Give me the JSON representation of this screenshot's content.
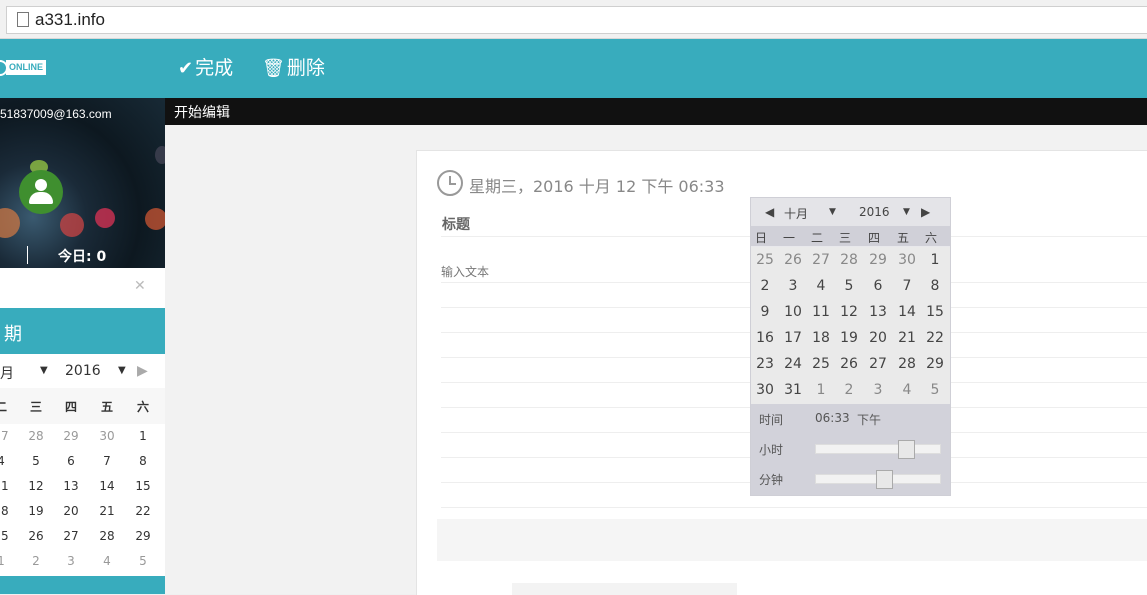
{
  "browser": {
    "url": "a331.info"
  },
  "topnav": {
    "logo_text": "ONLINE",
    "done_label": "完成",
    "delete_label": "删除"
  },
  "sidebar": {
    "email": "51837009@163.com",
    "today_label": "今日: ",
    "today_value": "0",
    "calendar_title": "期",
    "month_label": "月",
    "year_label": "2016",
    "weekdays": [
      "二",
      "三",
      "四",
      "五",
      "六"
    ],
    "weeks": [
      [
        "27",
        "28",
        "29",
        "30",
        "1"
      ],
      [
        "4",
        "5",
        "6",
        "7",
        "8"
      ],
      [
        "11",
        "12",
        "13",
        "14",
        "15"
      ],
      [
        "18",
        "19",
        "20",
        "21",
        "22"
      ],
      [
        "25",
        "26",
        "27",
        "28",
        "29"
      ],
      [
        "1",
        "2",
        "3",
        "4",
        "5"
      ]
    ]
  },
  "main": {
    "toolbar_label": "开始编辑",
    "datetime": "星期三，2016 十月 12 下午 06:33",
    "title_label": "标题",
    "text_placeholder": "输入文本"
  },
  "picker": {
    "month": "十月",
    "year": "2016",
    "weekdays": [
      "日",
      "一",
      "二",
      "三",
      "四",
      "五",
      "六"
    ],
    "weeks": [
      [
        "25",
        "26",
        "27",
        "28",
        "29",
        "30",
        "1"
      ],
      [
        "2",
        "3",
        "4",
        "5",
        "6",
        "7",
        "8"
      ],
      [
        "9",
        "10",
        "11",
        "12",
        "13",
        "14",
        "15"
      ],
      [
        "16",
        "17",
        "18",
        "19",
        "20",
        "21",
        "22"
      ],
      [
        "23",
        "24",
        "25",
        "26",
        "27",
        "28",
        "29"
      ],
      [
        "30",
        "31",
        "1",
        "2",
        "3",
        "4",
        "5"
      ]
    ],
    "time_label": "时间",
    "time_value": "06:33",
    "ampm": "下午",
    "hour_label": "小时",
    "minute_label": "分钟",
    "hour_level": 0.75,
    "minute_level": 0.55
  }
}
